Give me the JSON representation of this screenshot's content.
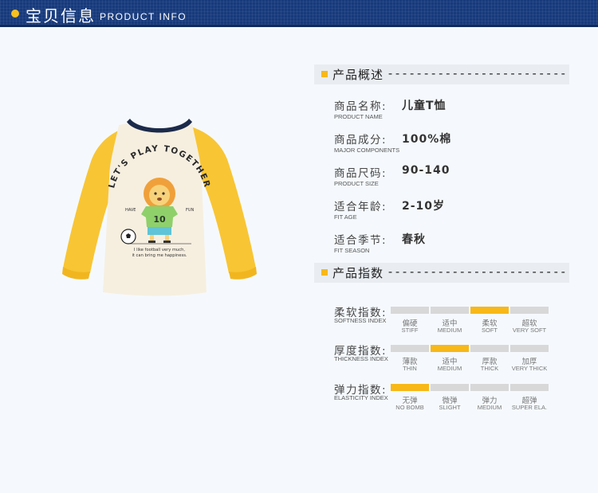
{
  "header": {
    "title_cn": "宝贝信息",
    "title_en": "PRODUCT INFO"
  },
  "colors": {
    "header": "#173a7c",
    "accent": "#f7b818",
    "shirt_body": "#f6efe0",
    "sleeve": "#f8c534",
    "collar": "#1c2a4a"
  },
  "shirt": {
    "print_arc": "LET'S PLAY TOGETHER",
    "number": "10",
    "left_small": "HAVE",
    "right_small": "FUN",
    "caption_line1": "I like football very much,",
    "caption_line2": "it can bring me happiness."
  },
  "overview": {
    "title": "产品概述",
    "dashes": "-------------------------",
    "items": [
      {
        "cn": "商品名称:",
        "en": "PRODUCT NAME",
        "value": "儿童T恤"
      },
      {
        "cn": "商品成分:",
        "en": "MAJOR COMPONENTS",
        "value": "100%棉"
      },
      {
        "cn": "商品尺码:",
        "en": "PRODUCT SIZE",
        "value": "90-140"
      },
      {
        "cn": "适合年龄:",
        "en": "FIT AGE",
        "value": "2-10岁"
      },
      {
        "cn": "适合季节:",
        "en": "FIT SEASON",
        "value": "春秋"
      }
    ]
  },
  "index": {
    "title": "产品指数",
    "dashes": "-------------------------",
    "rows": [
      {
        "cn": "柔软指数:",
        "en": "SOFTNESS INDEX",
        "selected": 2,
        "options": [
          {
            "cn": "偏硬",
            "en": "STIFF"
          },
          {
            "cn": "适中",
            "en": "MEDIUM"
          },
          {
            "cn": "柔软",
            "en": "SOFT"
          },
          {
            "cn": "超软",
            "en": "VERY SOFT"
          }
        ]
      },
      {
        "cn": "厚度指数:",
        "en": "THICKNESS INDEX",
        "selected": 1,
        "options": [
          {
            "cn": "薄款",
            "en": "THIN"
          },
          {
            "cn": "适中",
            "en": "MEDIUM"
          },
          {
            "cn": "厚款",
            "en": "THICK"
          },
          {
            "cn": "加厚",
            "en": "VERY THICK"
          }
        ]
      },
      {
        "cn": "弹力指数:",
        "en": "ELASTICITY INDEX",
        "selected": 0,
        "options": [
          {
            "cn": "无弹",
            "en": "NO BOMB"
          },
          {
            "cn": "微弹",
            "en": "SLIGHT"
          },
          {
            "cn": "弹力",
            "en": "MEDIUM"
          },
          {
            "cn": "超弹",
            "en": "SUPER ELA."
          }
        ]
      }
    ]
  }
}
